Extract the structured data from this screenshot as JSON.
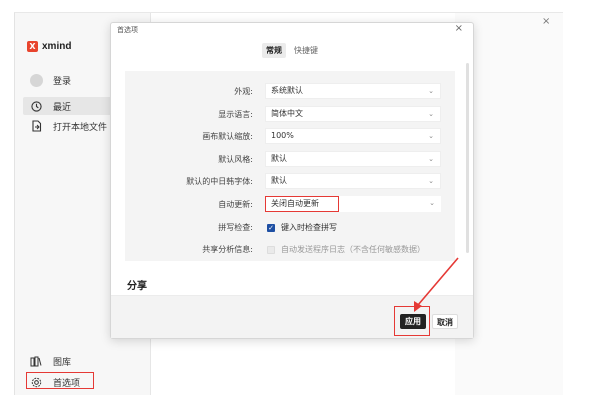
{
  "app": {
    "logo_text": "xmind",
    "logo_mark": "X",
    "outer_close": "×"
  },
  "sidebar": {
    "items": [
      {
        "label": "登录",
        "icon": "user-icon"
      },
      {
        "label": "最近",
        "icon": "clock-icon"
      },
      {
        "label": "打开本地文件",
        "icon": "open-file-icon"
      }
    ],
    "bottom": [
      {
        "label": "图库",
        "icon": "library-icon"
      },
      {
        "label": "首选项",
        "icon": "gear-icon"
      }
    ]
  },
  "dialog": {
    "title": "首选项",
    "close": "×",
    "tabs": [
      {
        "label": "常规",
        "active": true
      },
      {
        "label": "快捷键",
        "active": false
      }
    ],
    "settings": [
      {
        "label": "外观:",
        "value": "系统默认"
      },
      {
        "label": "显示语言:",
        "value": "简体中文"
      },
      {
        "label": "画布默认缩放:",
        "value": "100%"
      },
      {
        "label": "默认风格:",
        "value": "默认"
      },
      {
        "label": "默认的中日韩字体:",
        "value": "默认"
      },
      {
        "label": "自动更新:",
        "value": "关闭自动更新"
      }
    ],
    "spellcheck": {
      "label": "拼写检查:",
      "text": "键入时检查拼写",
      "checked": true
    },
    "analytics": {
      "label": "共享分析信息:",
      "text": "自动发送程序日志（不含任何敏感数据）",
      "checked": false
    },
    "share_heading": "分享",
    "apply_label": "应用",
    "cancel_label": "取消"
  },
  "colors": {
    "accent": "#1e4fa3",
    "highlight": "#e53935",
    "brand": "#e8442d"
  }
}
